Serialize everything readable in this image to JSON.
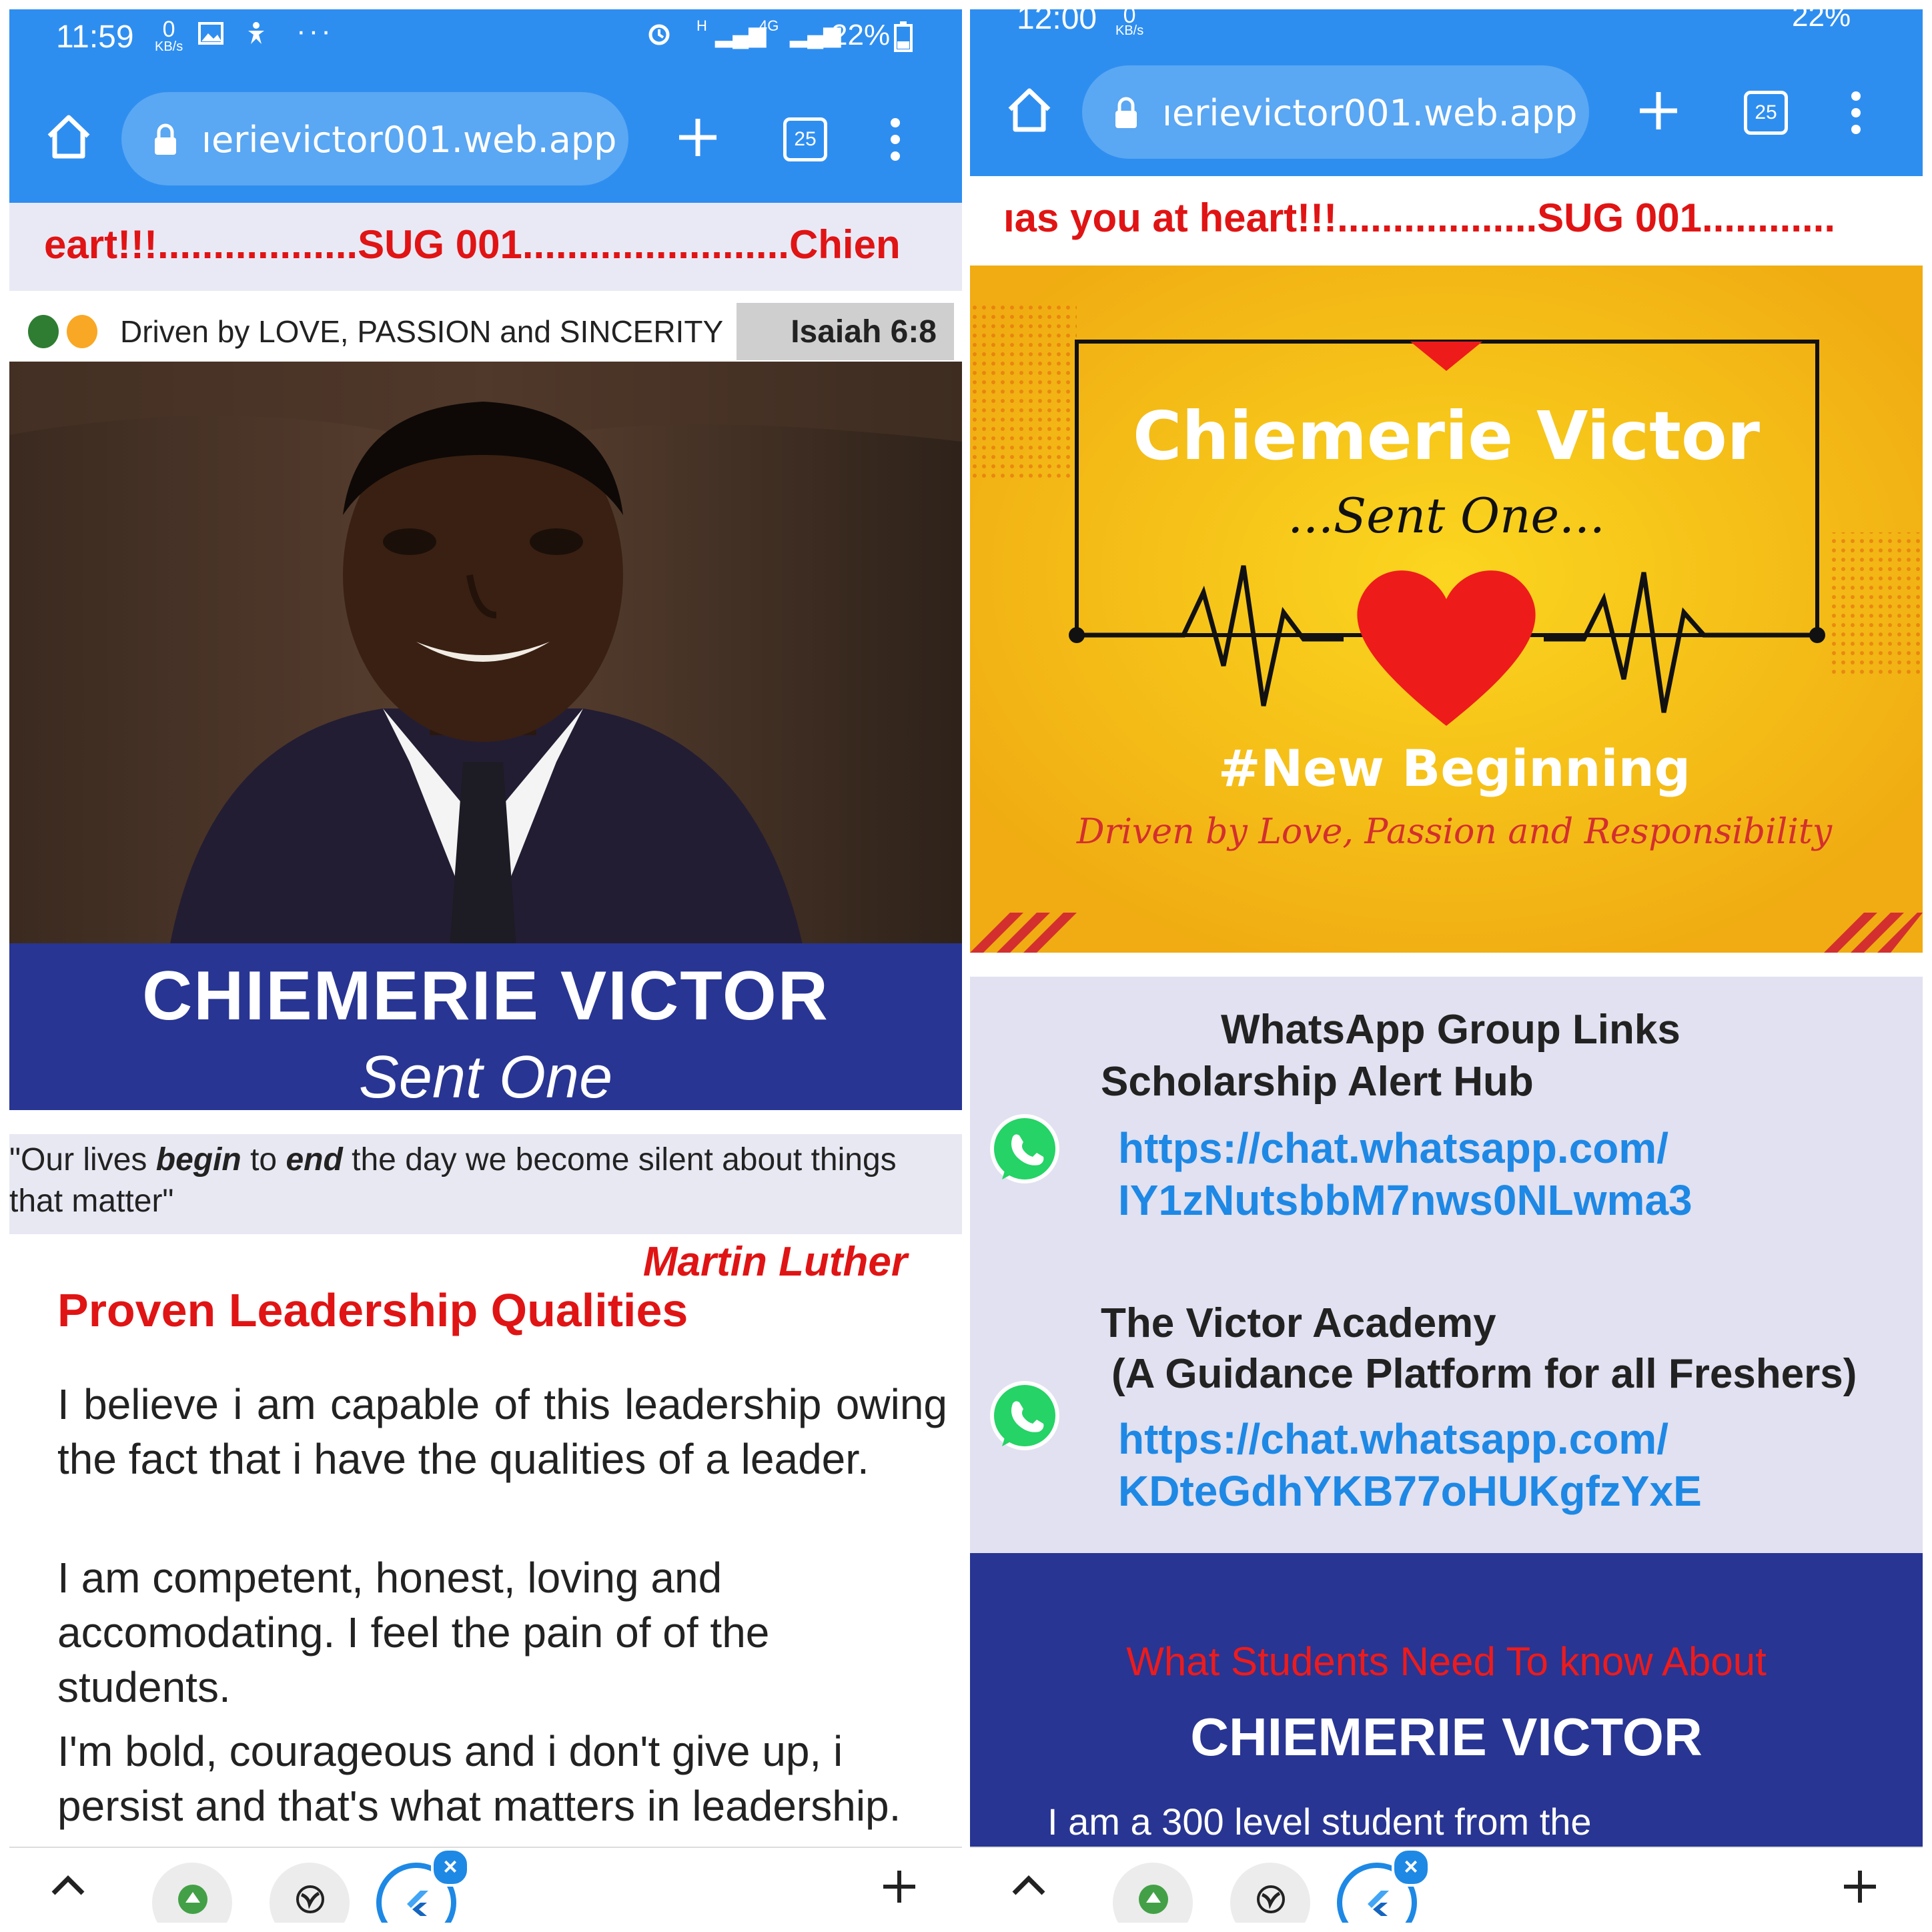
{
  "left_screen": {
    "status_bar": {
      "time": "11:59",
      "data_rate_value": "0",
      "data_rate_unit": "KB/s",
      "network": "H",
      "network_2": "4G",
      "battery": "22%"
    },
    "browser": {
      "url": "ıerievictor001.web.app",
      "tab_count": "25"
    },
    "marquee_text": "eart!!!..................SUG 001........................Chien",
    "tagline": "Driven by LOVE, PASSION and SINCERITY",
    "verse": "Isaiah 6:8",
    "name": "CHIEMERIE  VICTOR",
    "title": "Sent One",
    "quote": {
      "part1": "\"Our lives ",
      "begin": "begin",
      "part2": " to ",
      "end": "end",
      "part3": " the day we become silent about things that matter\""
    },
    "quote_author": "Martin Luther",
    "section_title": "Proven Leadership Qualities",
    "paragraphs": [
      "I believe i am capable of this leadership owing the fact that i have the qualities of a leader.",
      "I am competent, honest, loving and accomodating. I feel the pain of of the students.",
      "I'm bold, courageous and i don't give up, i persist and that's what matters in leadership."
    ]
  },
  "right_screen": {
    "status_bar": {
      "time": "12:00",
      "data_rate_value": "0",
      "data_rate_unit": "KB/s",
      "battery": "22%"
    },
    "browser": {
      "url": "ıerievictor001.web.app",
      "tab_count": "25"
    },
    "marquee_text": "ıas you at heart!!!..................SUG 001............",
    "banner": {
      "name": "Chiemerie Victor",
      "subtitle": "...Sent One...",
      "hashtag": "#New Beginning",
      "slogan": "Driven by Love, Passion and Responsibility"
    },
    "whatsapp": {
      "heading": "WhatsApp Group Links",
      "groups": [
        {
          "name": "Scholarship Alert Hub",
          "link_line1": "https://chat.whatsapp.com/",
          "link_line2": "IY1zNutsbbM7nws0NLwma3"
        },
        {
          "name": "The Victor Academy",
          "subtitle": "(A Guidance Platform for all Freshers)",
          "link_line1": "https://chat.whatsapp.com/",
          "link_line2": "KDteGdhYKB77oHUKgfzYxE"
        }
      ]
    },
    "about": {
      "intro": "What Students Need To know About",
      "name": "CHIEMERIE VICTOR",
      "text": "I am a 300 level student from the"
    }
  },
  "colors": {
    "browser_blue": "#2e8ef0",
    "marquee_red": "#e01414",
    "navy": "#283593",
    "link_blue": "#1e88e5",
    "banner_yellow": "#f5c316"
  },
  "icons": [
    "home-icon",
    "lock-icon",
    "plus-icon",
    "tabs-icon",
    "menu-icon",
    "whatsapp-icon",
    "chevron-up-icon",
    "globe-icon",
    "close-icon"
  ]
}
